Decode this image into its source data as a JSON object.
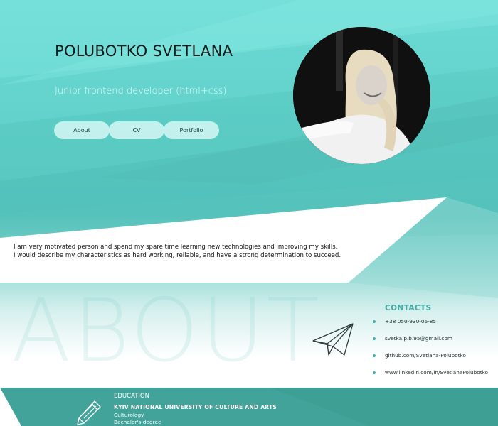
{
  "hero": {
    "name": "POLUBOTKO SVETLANA",
    "subtitle": "Junior frontend developer (html+css)"
  },
  "nav": {
    "about": "About",
    "cv": "CV",
    "portfolio": "Portfolio"
  },
  "intro": {
    "line1": "I am very motivated person and spend my spare time learning new technologies and improving my skills.",
    "line2": "I would describe my characteristics as hard working, reliable, and have a strong determination to succeed."
  },
  "about": {
    "watermark": "ABOUT"
  },
  "contacts": {
    "title": "CONTACTS",
    "items": [
      "+38 050-930-06-85",
      "svetka.p.b.95@gmail.com",
      "github.com/Svetlana-Polubotko",
      "www.linkedin.com/in/SvetlanaPolubotko"
    ]
  },
  "education": {
    "label": "EDUCATION",
    "university": "KYIV NATIONAL UNIVERSITY OF CULTURE AND ARTS",
    "field": "Culturology",
    "degree": "Bachelor's degree"
  },
  "colors": {
    "accent": "#44aaa3",
    "education_band": "#41a399",
    "hero_teal": "#5ccdc6"
  },
  "icons": {
    "avatar": "profile-photo",
    "plane": "paper-plane-icon",
    "pencil": "pencil-icon",
    "bullet": "bullet-dot-icon"
  }
}
